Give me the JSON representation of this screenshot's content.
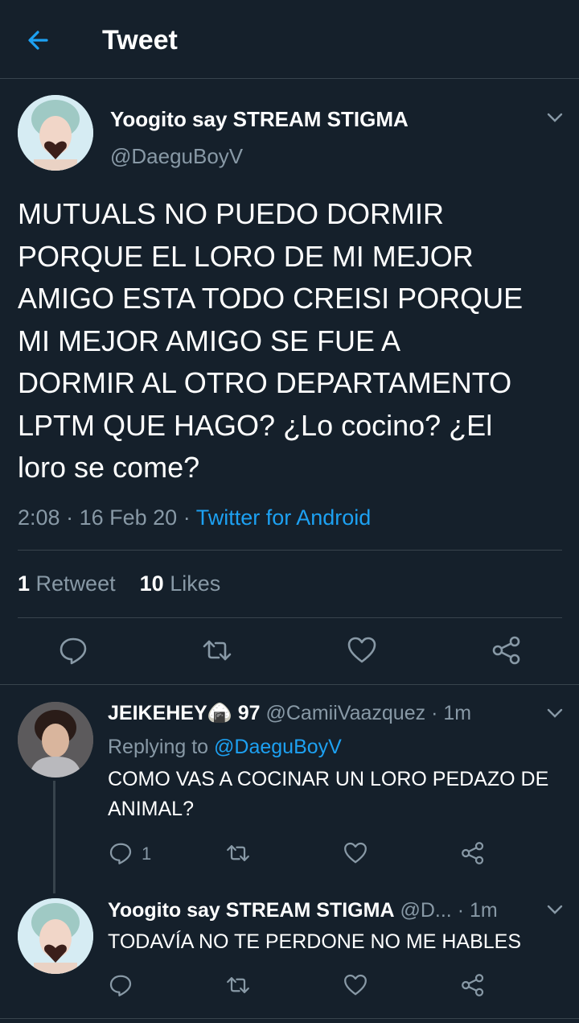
{
  "header": {
    "title": "Tweet",
    "back_icon": "arrow-left-icon"
  },
  "colors": {
    "background": "#15202b",
    "accent": "#1da1f2",
    "muted": "#8899a6",
    "divider": "#38444d"
  },
  "main_tweet": {
    "display_name": "Yoogito say STREAM STIGMA",
    "handle": "@DaeguBoyV",
    "text": "MUTUALS NO PUEDO DORMIR\nPORQUE EL LORO DE MI MEJOR\nAMIGO ESTA TODO CREISI PORQUE\nMI MEJOR AMIGO SE FUE A\nDORMIR AL OTRO DEPARTAMENTO\nLPTM QUE HAGO? ¿Lo cocino? ¿El\nloro se come?",
    "time": "2:08",
    "dot1": "·",
    "date": "16 Feb 20",
    "dot2": "·",
    "source": "Twitter for Android",
    "retweet_count": "1",
    "retweet_label": "Retweet",
    "like_count": "10",
    "like_label": "Likes"
  },
  "replies": [
    {
      "display_name": "JEIKEHEY🍙 97",
      "handle": "@CamiiVaazquez",
      "dot": "·",
      "time": "1m",
      "replying_label": "Replying to",
      "replying_to": "@DaeguBoyV",
      "text": "COMO VAS A COCINAR UN LORO PEDAZO DE ANIMAL?",
      "reply_count": "1"
    },
    {
      "display_name": "Yoogito say STREAM STIGMA",
      "handle": "@D...",
      "dot": "·",
      "time": "1m",
      "text": "TODAVÍA NO TE PERDONE NO ME HABLES"
    }
  ]
}
